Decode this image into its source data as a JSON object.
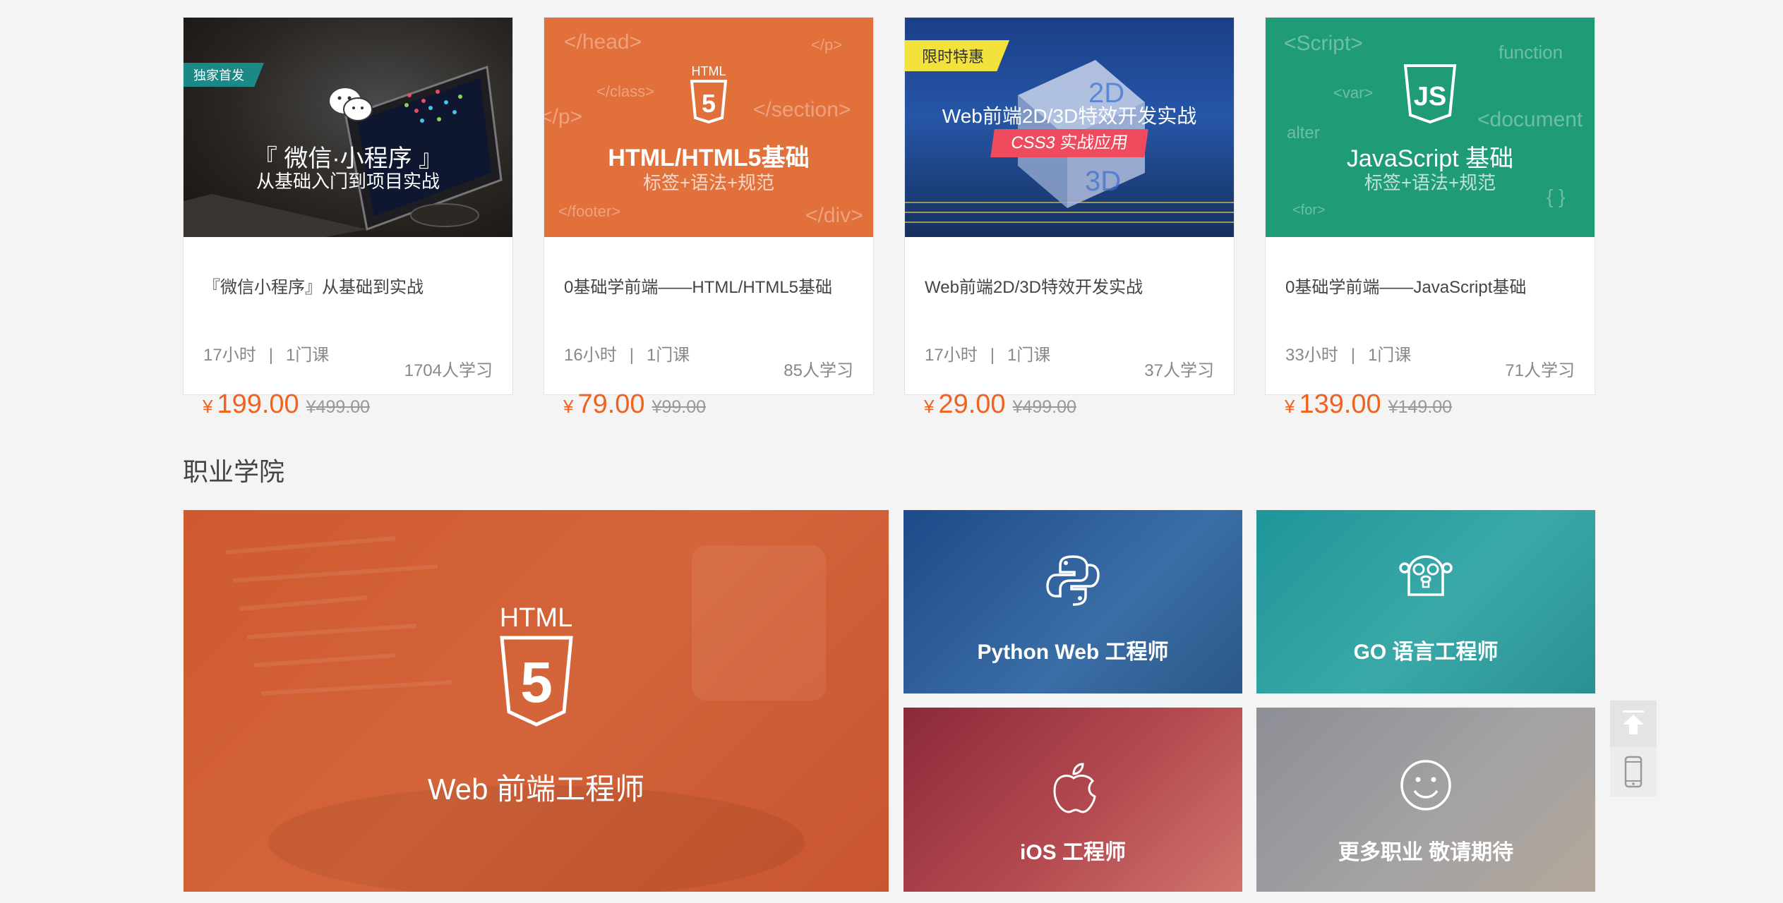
{
  "courses": [
    {
      "cover_title": "『 微信·小程序 』",
      "cover_subtitle": "从基础入门到项目实战",
      "badge": "独家首发",
      "title": "『微信小程序』从基础到实战",
      "hours": "17小时",
      "lessons": "1门课",
      "students": "1704人学习",
      "currency": "¥",
      "price": "199.00",
      "old_price": "¥499.00"
    },
    {
      "cover_logo": "HTML",
      "cover_title": "HTML/HTML5基础",
      "cover_subtitle": "标签+语法+规范",
      "code_words": [
        "</head>",
        "</p>",
        "</class>",
        "</section>",
        "</p>",
        "</footer>",
        "</div>"
      ],
      "title": "0基础学前端——HTML/HTML5基础",
      "hours": "16小时",
      "lessons": "1门课",
      "students": "85人学习",
      "currency": "¥",
      "price": "79.00",
      "old_price": "¥99.00"
    },
    {
      "badge": "限时特惠",
      "cover_title": "Web前端2D/3D特效开发实战",
      "cover_subtitle": "CSS3 实战应用",
      "title": "Web前端2D/3D特效开发实战",
      "hours": "17小时",
      "lessons": "1门课",
      "students": "37人学习",
      "currency": "¥",
      "price": "29.00",
      "old_price": "¥499.00"
    },
    {
      "cover_title": "JavaScript 基础",
      "cover_subtitle": "标签+语法+规范",
      "code_words": [
        "<Script>",
        "function",
        "<var>",
        "alter",
        "<document",
        "<for>",
        "{ }"
      ],
      "title": "0基础学前端——JavaScript基础",
      "hours": "33小时",
      "lessons": "1门课",
      "students": "71人学习",
      "currency": "¥",
      "price": "139.00",
      "old_price": "¥149.00"
    }
  ],
  "career": {
    "section_title": "职业学院",
    "web_logo": "HTML",
    "web": "Web 前端工程师",
    "python": "Python Web 工程师",
    "go": "GO 语言工程师",
    "ios": "iOS 工程师",
    "more": "更多职业 敬请期待"
  },
  "colors": {
    "accent": "#f0621d",
    "html_orange": "#e2703a",
    "js_green": "#1f9c77",
    "ribbon_teal": "#1b8a86",
    "ribbon_yellow": "#f4e23c"
  },
  "icons": [
    "wechat-icon",
    "html5-icon",
    "js-icon",
    "python-icon",
    "go-icon",
    "apple-icon",
    "smile-icon",
    "back-to-top-icon",
    "phone-icon"
  ]
}
